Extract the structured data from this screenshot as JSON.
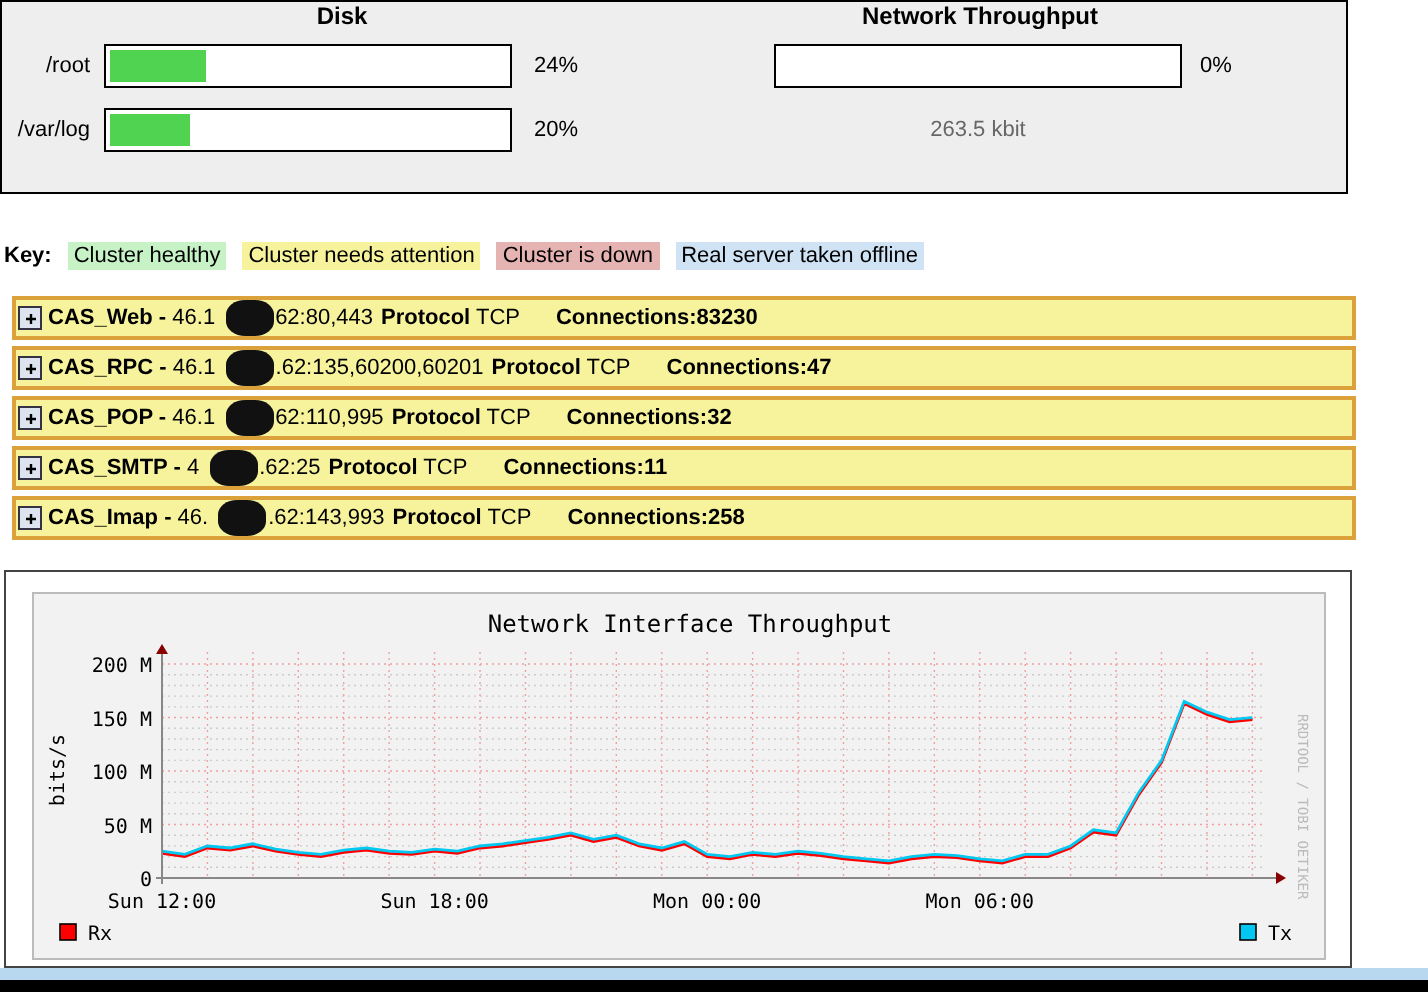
{
  "status_panel": {
    "disk": {
      "heading": "Disk",
      "items": [
        {
          "label": "/root",
          "level": 0.24,
          "reading": "24%"
        },
        {
          "label": "/var/log",
          "level": 0.2,
          "reading": "20%"
        }
      ]
    },
    "network": {
      "heading": "Network Throughput",
      "reading": "0%",
      "rate": "263.5 kbit"
    }
  },
  "key": {
    "label": "Key:",
    "items": [
      {
        "label": "Cluster healthy",
        "color": "#c6f2c6"
      },
      {
        "label": "Cluster needs attention",
        "color": "#f7f39c"
      },
      {
        "label": "Cluster is down",
        "color": "#e6b3b3"
      },
      {
        "label": "Real server taken offline",
        "color": "#cfe3f5"
      }
    ]
  },
  "clusters": [
    {
      "name": "CAS_Web -",
      "address_start": "46.1",
      "address_end": "62:80,443",
      "protocol_label": "Protocol",
      "protocol": "TCP",
      "connections": "Connections:83230",
      "color": "#f7f39c",
      "expanded": false
    },
    {
      "name": "CAS_RPC -",
      "address_start": "46.1",
      "address_end": ".62:135,60200,60201",
      "protocol_label": "Protocol",
      "protocol": "TCP",
      "connections": "Connections:47",
      "color": "#f7f39c",
      "expanded": false
    },
    {
      "name": "CAS_POP -",
      "address_start": "46.1",
      "address_end": "62:110,995",
      "protocol_label": "Protocol",
      "protocol": "TCP",
      "connections": "Connections:32",
      "color": "#f7f39c",
      "expanded": false
    },
    {
      "name": "CAS_SMTP -",
      "address_start": "4",
      "address_end": ".62:25",
      "protocol_label": "Protocol",
      "protocol": "TCP",
      "connections": "Connections:11",
      "color": "#f7f39c",
      "expanded": false
    },
    {
      "name": "CAS_Imap -",
      "address_start": "46.",
      "address_end": ".62:143,993",
      "protocol_label": "Protocol",
      "protocol": "TCP",
      "connections": "Connections:258",
      "color": "#f7f39c",
      "expanded": false
    }
  ],
  "graph": {
    "side_label": "RRDTOOL / TOBI OETIKER",
    "chart_data": {
      "type": "line",
      "title": "Network Interface Throughput",
      "ylabel": "bits/s",
      "categories": [
        "Sun 12:00",
        null,
        null,
        null,
        null,
        null,
        null,
        null,
        null,
        null,
        null,
        null,
        "Sun 18:00",
        null,
        null,
        null,
        null,
        null,
        null,
        null,
        null,
        null,
        null,
        null,
        "Mon 00:00",
        null,
        null,
        null,
        null,
        null,
        null,
        null,
        null,
        null,
        null,
        null,
        "Mon 06:00",
        null,
        null,
        null,
        null,
        null,
        null,
        null,
        null,
        null,
        null,
        null,
        null
      ],
      "series": [
        {
          "name": "Rx",
          "color": "#ff0000",
          "values": [
            23,
            20,
            28,
            26,
            30,
            25,
            22,
            20,
            24,
            26,
            23,
            22,
            25,
            23,
            28,
            30,
            33,
            36,
            40,
            34,
            38,
            30,
            26,
            32,
            20,
            18,
            22,
            20,
            23,
            21,
            18,
            16,
            14,
            18,
            20,
            19,
            16,
            14,
            20,
            20,
            28,
            43,
            40,
            78,
            108,
            163,
            153,
            146,
            148
          ]
        },
        {
          "name": "Tx",
          "color": "#00c8f0",
          "values": [
            25,
            22,
            30,
            28,
            32,
            27,
            24,
            22,
            26,
            28,
            25,
            24,
            27,
            25,
            30,
            32,
            35,
            38,
            42,
            36,
            40,
            32,
            28,
            34,
            22,
            20,
            24,
            22,
            25,
            23,
            20,
            18,
            16,
            20,
            22,
            21,
            18,
            16,
            22,
            22,
            30,
            45,
            42,
            80,
            110,
            165,
            155,
            148,
            150
          ]
        }
      ],
      "ylim": [
        0,
        215
      ],
      "grid": true,
      "legend": "bottom",
      "yticks": [
        {
          "value": 0,
          "label": "0"
        },
        {
          "value": 50,
          "label": "50 M"
        },
        {
          "value": 100,
          "label": "100 M"
        },
        {
          "value": 150,
          "label": "150 M"
        },
        {
          "value": 200,
          "label": "200 M"
        }
      ]
    }
  }
}
